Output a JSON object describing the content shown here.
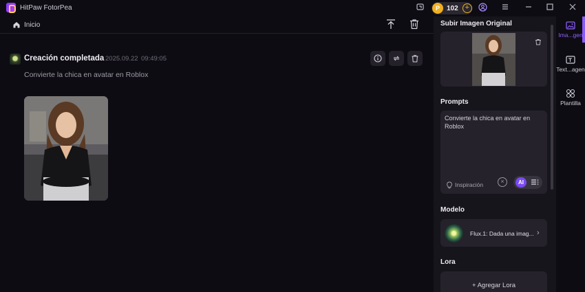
{
  "app": {
    "title": "HitPaw FotorPea",
    "credits": "102"
  },
  "nav": {
    "home_label": "Inicio"
  },
  "creation": {
    "status": "Creación completada",
    "date": "2025.09.22",
    "time": "09:49:05",
    "prompt": "Convierte la chica en avatar en Roblox"
  },
  "panel": {
    "upload_title": "Subir Imagen Original",
    "prompts_title": "Prompts",
    "prompt_value": "Convierte la chica en avatar en Roblox",
    "inspiration_label": "Inspiración",
    "ai_label": "AI",
    "model_title": "Modelo",
    "model_name": "Flux.1: Dada una imag...",
    "lora_title": "Lora",
    "lora_add": "+ Agregar Lora"
  },
  "rail": {
    "items": [
      {
        "label": "Ima...gen",
        "icon": "image-icon",
        "active": true
      },
      {
        "label": "Text...agen",
        "icon": "text-image-icon",
        "active": false
      },
      {
        "label": "Plantilla",
        "icon": "template-icon",
        "active": false
      }
    ]
  },
  "colors": {
    "accent": "#8a5cf6",
    "coin": "#f2b01e",
    "bg": "#0e0c13",
    "panel": "#17151c"
  }
}
